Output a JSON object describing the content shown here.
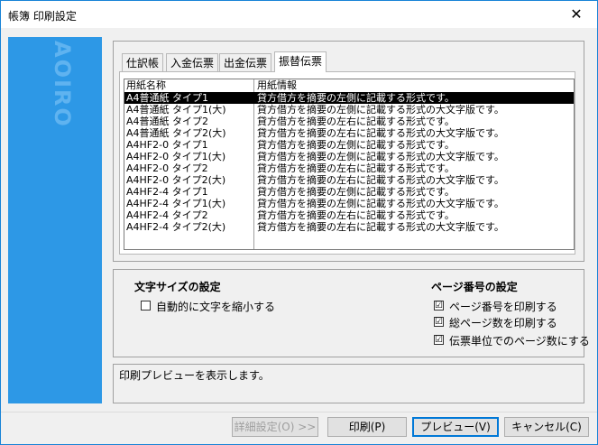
{
  "window": {
    "title": "帳簿 印刷設定",
    "close_glyph": "✕"
  },
  "brand": {
    "logo_text": "AOIRO"
  },
  "tabs": [
    "仕訳帳",
    "入金伝票",
    "出金伝票",
    "振替伝票"
  ],
  "list": {
    "headers": [
      "用紙名称",
      "用紙情報"
    ],
    "rows": [
      [
        "A4普通紙 タイプ1",
        "貸方借方を摘要の左側に記載する形式です。"
      ],
      [
        "A4普通紙 タイプ1(大)",
        "貸方借方を摘要の左側に記載する形式の大文字版です。"
      ],
      [
        "A4普通紙 タイプ2",
        "貸方借方を摘要の左右に記載する形式です。"
      ],
      [
        "A4普通紙 タイプ2(大)",
        "貸方借方を摘要の左右に記載する形式の大文字版です。"
      ],
      [
        "A4HF2-0 タイプ1",
        "貸方借方を摘要の左側に記載する形式です。"
      ],
      [
        "A4HF2-0 タイプ1(大)",
        "貸方借方を摘要の左側に記載する形式の大文字版です。"
      ],
      [
        "A4HF2-0 タイプ2",
        "貸方借方を摘要の左右に記載する形式です。"
      ],
      [
        "A4HF2-0 タイプ2(大)",
        "貸方借方を摘要の左右に記載する形式の大文字版です。"
      ],
      [
        "A4HF2-4 タイプ1",
        "貸方借方を摘要の左側に記載する形式です。"
      ],
      [
        "A4HF2-4 タイプ1(大)",
        "貸方借方を摘要の左側に記載する形式の大文字版です。"
      ],
      [
        "A4HF2-4 タイプ2",
        "貸方借方を摘要の左右に記載する形式です。"
      ],
      [
        "A4HF2-4 タイプ2(大)",
        "貸方借方を摘要の左右に記載する形式の大文字版です。"
      ]
    ]
  },
  "font_size": {
    "title": "文字サイズの設定",
    "auto_shrink": "自動的に文字を縮小する"
  },
  "page_number": {
    "title": "ページ番号の設定",
    "print_page_number": "ページ番号を印刷する",
    "print_total_pages": "総ページ数を印刷する",
    "per_slip": "伝票単位でのページ数にする"
  },
  "status": {
    "message": "印刷プレビューを表示します。"
  },
  "buttons": {
    "details": "詳細設定(O) >>",
    "print": "印刷(P)",
    "preview": "プレビュー(V)",
    "cancel": "キャンセル(C)"
  },
  "checked_glyph": "☑"
}
